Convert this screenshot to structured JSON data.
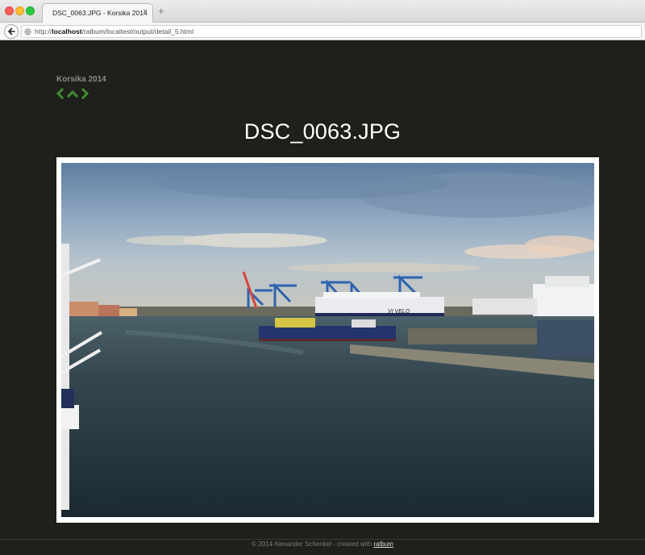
{
  "browser": {
    "tab_title": "DSC_0063.JPG - Korsika 2014",
    "tab_close": "×",
    "new_tab": "+",
    "url_prefix": "http://",
    "url_host": "localhost",
    "url_path": "/ralbum/localtest/output/detail_5.html"
  },
  "page": {
    "album_title": "Korsika 2014",
    "photo_title": "DSC_0063.JPG",
    "nav": {
      "prev_icon": "chevron-left-icon",
      "up_icon": "chevron-up-icon",
      "next_icon": "chevron-right-icon",
      "color": "#3c8e2c"
    },
    "footer_text": "© 2014 Alexander Schenkel - created with",
    "footer_link": "ralbum"
  },
  "photo": {
    "ship_name": "VI VELO"
  },
  "colors": {
    "page_background": "#1f1f1b",
    "frame": "#ffffff",
    "nav_accent": "#3c8e2c"
  }
}
